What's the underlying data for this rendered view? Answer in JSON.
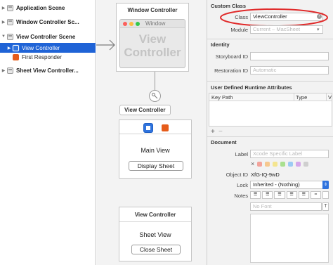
{
  "outline": {
    "items": [
      {
        "label": "Application Scene",
        "disclosure": "▶",
        "icon": "scene-icon"
      },
      {
        "label": "Window Controller Sc...",
        "disclosure": "▶",
        "icon": "scene-icon"
      },
      {
        "label": "View Controller Scene",
        "disclosure": "▼",
        "icon": "scene-icon"
      },
      {
        "label": "View Controller",
        "disclosure": "▶",
        "icon": "view-controller-icon",
        "selected": true
      },
      {
        "label": "First Responder",
        "disclosure": "",
        "icon": "first-responder-icon"
      },
      {
        "label": "Sheet View Controller...",
        "disclosure": "▶",
        "icon": "scene-icon"
      }
    ]
  },
  "canvas": {
    "window_scene": {
      "title": "Window Controller",
      "window_title": "Window",
      "placeholder_line1": "View",
      "placeholder_line2": "Controller"
    },
    "view_scene": {
      "tooltip": "View Controller",
      "main_label": "Main View",
      "button_label": "Display Sheet"
    },
    "sheet_scene": {
      "title": "View Controller",
      "main_label": "Sheet View",
      "button_label": "Close Sheet"
    }
  },
  "inspector": {
    "custom_class": {
      "title": "Custom Class",
      "class_label": "Class",
      "class_value": "ViewController",
      "module_label": "Module",
      "module_placeholder": "Current – MacSheet"
    },
    "identity": {
      "title": "Identity",
      "storyboard_label": "Storyboard ID",
      "restoration_label": "Restoration ID",
      "restoration_placeholder": "Automatic"
    },
    "runtime": {
      "title": "User Defined Runtime Attributes",
      "col_key": "Key Path",
      "col_type": "Type",
      "col_value": "V",
      "add": "+",
      "remove": "−"
    },
    "document": {
      "title": "Document",
      "label_label": "Label",
      "label_placeholder": "Xcode Specific Label",
      "object_id_label": "Object ID",
      "object_id_value": "XfG-IQ-9wD",
      "lock_label": "Lock",
      "lock_value": "Inherited - (Nothing)",
      "notes_label": "Notes",
      "font_placeholder": "No Font",
      "swatch_clear": "×",
      "swatch_colors": [
        "#f2a39b",
        "#f6c88f",
        "#f4e58f",
        "#a9e08f",
        "#9ccaf3",
        "#d5a7ea",
        "#cfcfcf"
      ]
    },
    "highlight_color": "#e02a2a",
    "accent": "#1f63d6"
  }
}
